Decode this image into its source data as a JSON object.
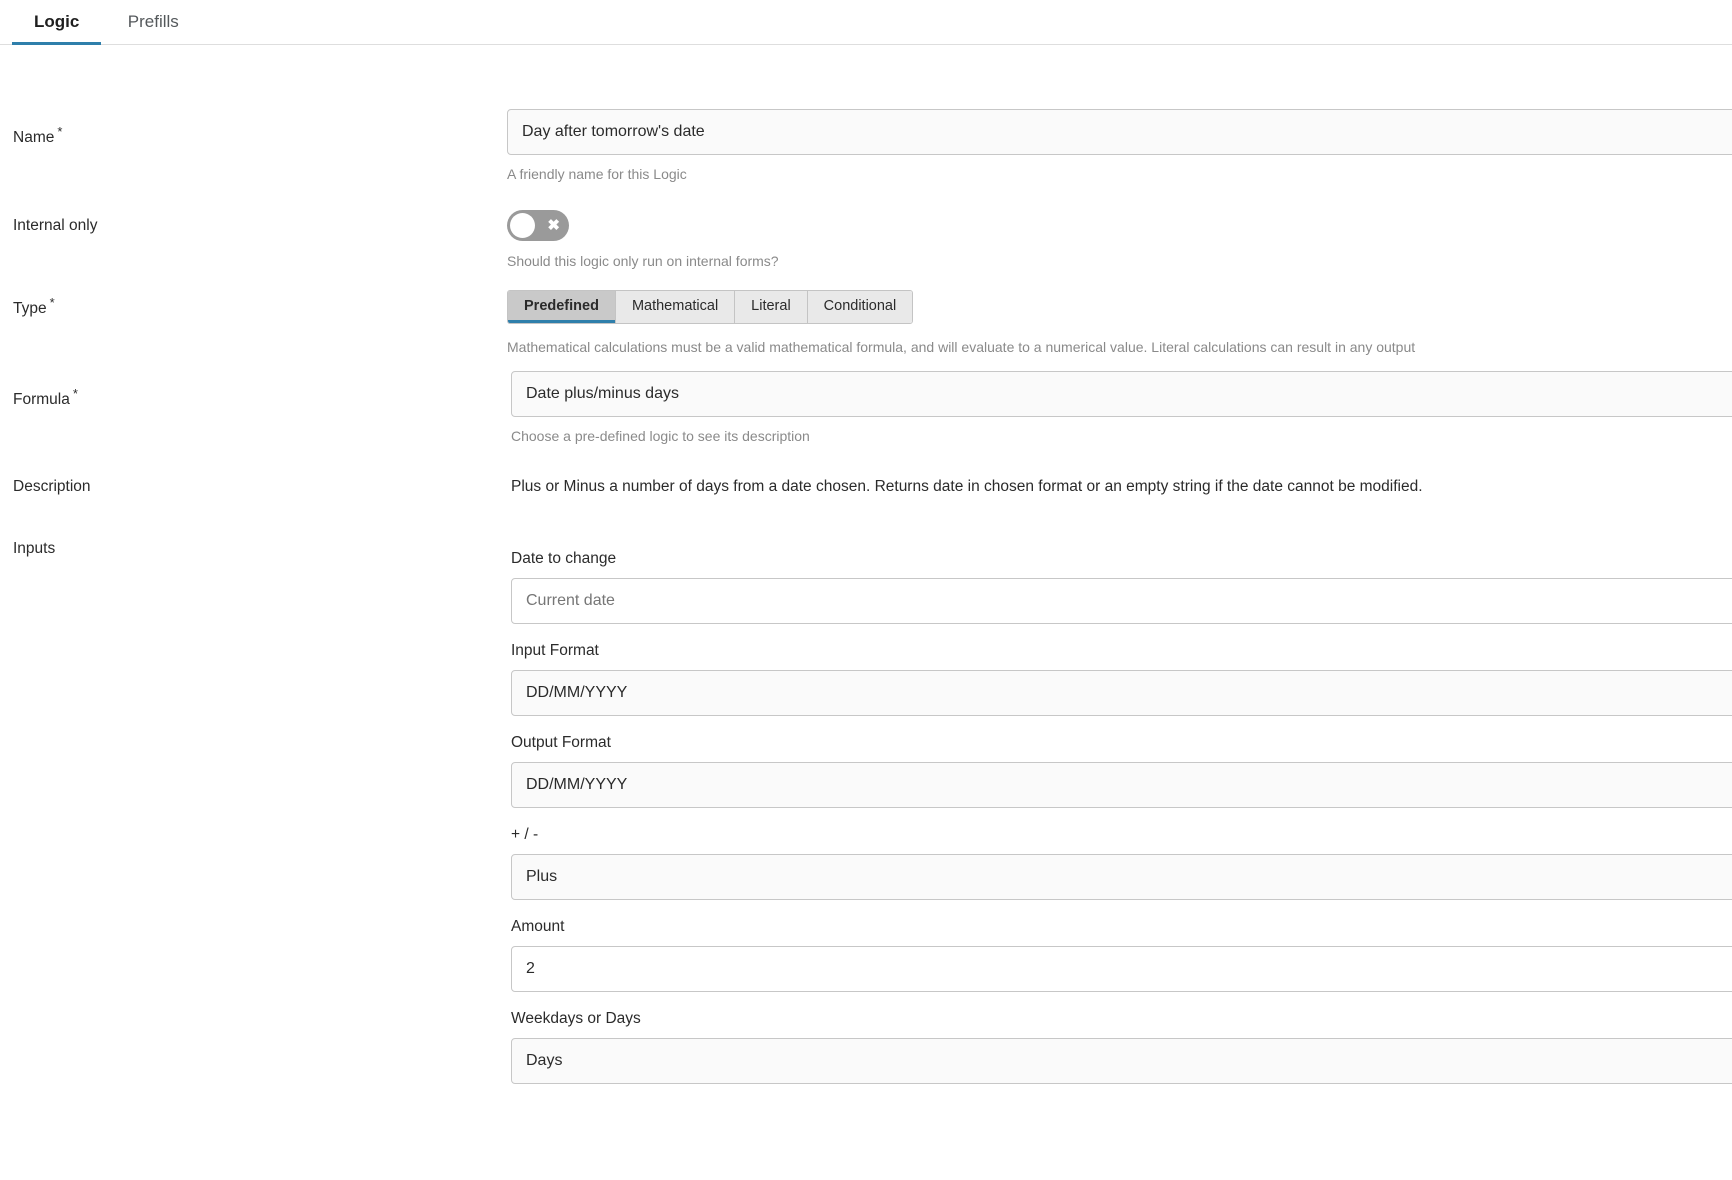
{
  "tabs": [
    {
      "label": "Logic",
      "active": true
    },
    {
      "label": "Prefills",
      "active": false
    }
  ],
  "accent_color": "#2f7fab",
  "form": {
    "name": {
      "label": "Name",
      "required": "*",
      "value": "Day after tomorrow's date",
      "help": "A friendly name for this Logic"
    },
    "internal_only": {
      "label": "Internal only",
      "state": "off",
      "mark": "✖",
      "help": "Should this logic only run on internal forms?"
    },
    "type": {
      "label": "Type",
      "required": "*",
      "options": [
        "Predefined",
        "Mathematical",
        "Literal",
        "Conditional"
      ],
      "selected": "Predefined",
      "help": "Mathematical calculations must be a valid mathematical formula, and will evaluate to a numerical value. Literal calculations can result in any output"
    },
    "formula": {
      "label": "Formula",
      "required": "*",
      "value": "Date plus/minus days",
      "help": "Choose a pre-defined logic to see its description"
    },
    "description": {
      "label": "Description",
      "text": "Plus or Minus a number of days from a date chosen. Returns date in chosen format or an empty string if the date cannot be modified."
    },
    "inputs": {
      "label": "Inputs",
      "fields": [
        {
          "label": "Date to change",
          "value": "Current date",
          "style": "placeholder"
        },
        {
          "label": "Input Format",
          "value": "DD/MM/YYYY",
          "style": "filled"
        },
        {
          "label": "Output Format",
          "value": "DD/MM/YYYY",
          "style": "filled"
        },
        {
          "label": "+ / -",
          "value": "Plus",
          "style": "filled"
        },
        {
          "label": "Amount",
          "value": "2",
          "style": "white"
        },
        {
          "label": "Weekdays or Days",
          "value": "Days",
          "style": "filled"
        }
      ]
    }
  }
}
